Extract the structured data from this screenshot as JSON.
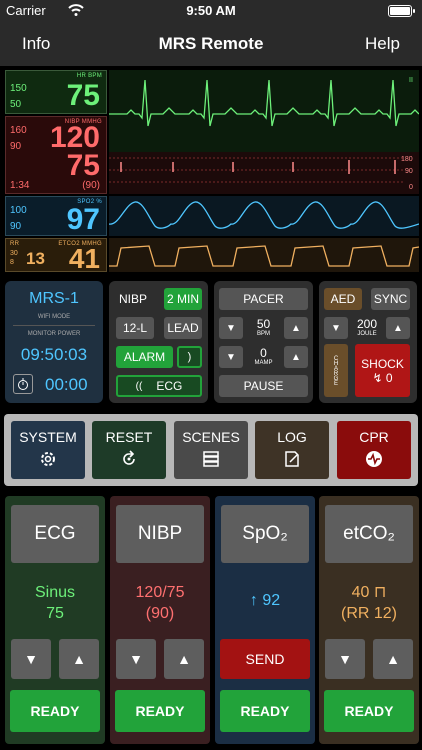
{
  "status_bar": {
    "carrier": "Carrier",
    "time": "9:50 AM"
  },
  "nav": {
    "left": "Info",
    "title": "MRS Remote",
    "right": "Help"
  },
  "monitor": {
    "hr": {
      "label": "HR BPM",
      "upper": "150",
      "lower": "50",
      "value": "75",
      "color": "#6df07a"
    },
    "nibp": {
      "label": "NIBP MMHG",
      "upper": "160",
      "lower": "90",
      "sys": "120",
      "dia": "75",
      "time": "1:34",
      "mean": "(90)",
      "color": "#ff6b6b"
    },
    "spo2": {
      "label": "SPO2 %",
      "upper": "100",
      "lower": "90",
      "value": "97",
      "color": "#4fc6ff"
    },
    "etco2": {
      "label": "ETCO2 MMHG",
      "rr_label": "RR",
      "upper": "30",
      "lower": "8",
      "rr": "13",
      "value": "41",
      "color": "#f0b060"
    },
    "strip_labels": {
      "ecg_marker": "II",
      "nibp_scale": [
        "180",
        "90",
        "0"
      ]
    }
  },
  "device": {
    "name": "MRS-1",
    "wifi": "WIFI MODE",
    "power": "MONITOR POWER",
    "clock": "09:50:03",
    "timer": "00:00"
  },
  "nibp_panel": {
    "nibp": "NIBP",
    "interval": "2 MIN",
    "lead12": "12-L",
    "lead": "LEAD",
    "alarm": "ALARM",
    "ecg": "ECG"
  },
  "pacer": {
    "title": "PACER",
    "rate": "50",
    "rate_unit": "BPM",
    "current": "0",
    "current_unit": "MAMP",
    "pause": "PAUSE"
  },
  "defib": {
    "aed": "AED",
    "sync": "SYNC",
    "energy": "200",
    "energy_unit": "JOULE",
    "charge": "CHARGE",
    "shock": "SHOCK",
    "shock_count": "↯ 0"
  },
  "main_buttons": [
    {
      "label": "SYSTEM",
      "icon": "gear-icon"
    },
    {
      "label": "RESET",
      "icon": "reset-icon"
    },
    {
      "label": "SCENES",
      "icon": "stack-icon"
    },
    {
      "label": "LOG",
      "icon": "note-icon"
    },
    {
      "label": "CPR",
      "icon": "heartbeat-icon"
    }
  ],
  "cards": {
    "ecg": {
      "title": "ECG",
      "line1": "Sinus",
      "line2": "75",
      "ready": "READY"
    },
    "nibp": {
      "title": "NIBP",
      "line1": "120/75",
      "line2": "(90)",
      "ready": "READY"
    },
    "spo2": {
      "title": "SpO₂",
      "line1": "↑ 92",
      "send": "SEND",
      "ready": "READY"
    },
    "etco2": {
      "title": "etCO₂",
      "line1": "40 ⊓",
      "line2": "(RR 12)",
      "ready": "READY"
    }
  },
  "arrows": {
    "down": "▼",
    "up": "▲"
  }
}
